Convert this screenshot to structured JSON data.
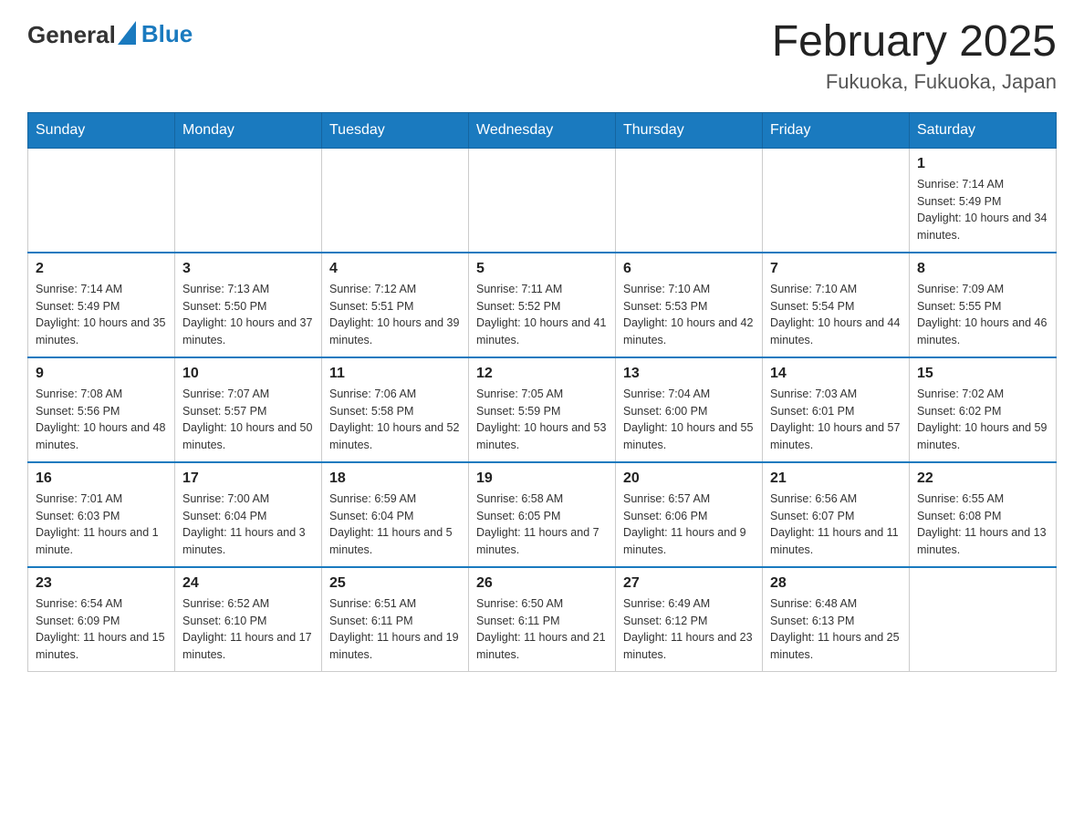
{
  "header": {
    "logo_general": "General",
    "logo_blue": "Blue",
    "title": "February 2025",
    "subtitle": "Fukuoka, Fukuoka, Japan"
  },
  "days_of_week": [
    "Sunday",
    "Monday",
    "Tuesday",
    "Wednesday",
    "Thursday",
    "Friday",
    "Saturday"
  ],
  "weeks": [
    {
      "days": [
        {
          "number": "",
          "sunrise": "",
          "sunset": "",
          "daylight": ""
        },
        {
          "number": "",
          "sunrise": "",
          "sunset": "",
          "daylight": ""
        },
        {
          "number": "",
          "sunrise": "",
          "sunset": "",
          "daylight": ""
        },
        {
          "number": "",
          "sunrise": "",
          "sunset": "",
          "daylight": ""
        },
        {
          "number": "",
          "sunrise": "",
          "sunset": "",
          "daylight": ""
        },
        {
          "number": "",
          "sunrise": "",
          "sunset": "",
          "daylight": ""
        },
        {
          "number": "1",
          "sunrise": "Sunrise: 7:14 AM",
          "sunset": "Sunset: 5:49 PM",
          "daylight": "Daylight: 10 hours and 34 minutes."
        }
      ]
    },
    {
      "days": [
        {
          "number": "2",
          "sunrise": "Sunrise: 7:14 AM",
          "sunset": "Sunset: 5:49 PM",
          "daylight": "Daylight: 10 hours and 35 minutes."
        },
        {
          "number": "3",
          "sunrise": "Sunrise: 7:13 AM",
          "sunset": "Sunset: 5:50 PM",
          "daylight": "Daylight: 10 hours and 37 minutes."
        },
        {
          "number": "4",
          "sunrise": "Sunrise: 7:12 AM",
          "sunset": "Sunset: 5:51 PM",
          "daylight": "Daylight: 10 hours and 39 minutes."
        },
        {
          "number": "5",
          "sunrise": "Sunrise: 7:11 AM",
          "sunset": "Sunset: 5:52 PM",
          "daylight": "Daylight: 10 hours and 41 minutes."
        },
        {
          "number": "6",
          "sunrise": "Sunrise: 7:10 AM",
          "sunset": "Sunset: 5:53 PM",
          "daylight": "Daylight: 10 hours and 42 minutes."
        },
        {
          "number": "7",
          "sunrise": "Sunrise: 7:10 AM",
          "sunset": "Sunset: 5:54 PM",
          "daylight": "Daylight: 10 hours and 44 minutes."
        },
        {
          "number": "8",
          "sunrise": "Sunrise: 7:09 AM",
          "sunset": "Sunset: 5:55 PM",
          "daylight": "Daylight: 10 hours and 46 minutes."
        }
      ]
    },
    {
      "days": [
        {
          "number": "9",
          "sunrise": "Sunrise: 7:08 AM",
          "sunset": "Sunset: 5:56 PM",
          "daylight": "Daylight: 10 hours and 48 minutes."
        },
        {
          "number": "10",
          "sunrise": "Sunrise: 7:07 AM",
          "sunset": "Sunset: 5:57 PM",
          "daylight": "Daylight: 10 hours and 50 minutes."
        },
        {
          "number": "11",
          "sunrise": "Sunrise: 7:06 AM",
          "sunset": "Sunset: 5:58 PM",
          "daylight": "Daylight: 10 hours and 52 minutes."
        },
        {
          "number": "12",
          "sunrise": "Sunrise: 7:05 AM",
          "sunset": "Sunset: 5:59 PM",
          "daylight": "Daylight: 10 hours and 53 minutes."
        },
        {
          "number": "13",
          "sunrise": "Sunrise: 7:04 AM",
          "sunset": "Sunset: 6:00 PM",
          "daylight": "Daylight: 10 hours and 55 minutes."
        },
        {
          "number": "14",
          "sunrise": "Sunrise: 7:03 AM",
          "sunset": "Sunset: 6:01 PM",
          "daylight": "Daylight: 10 hours and 57 minutes."
        },
        {
          "number": "15",
          "sunrise": "Sunrise: 7:02 AM",
          "sunset": "Sunset: 6:02 PM",
          "daylight": "Daylight: 10 hours and 59 minutes."
        }
      ]
    },
    {
      "days": [
        {
          "number": "16",
          "sunrise": "Sunrise: 7:01 AM",
          "sunset": "Sunset: 6:03 PM",
          "daylight": "Daylight: 11 hours and 1 minute."
        },
        {
          "number": "17",
          "sunrise": "Sunrise: 7:00 AM",
          "sunset": "Sunset: 6:04 PM",
          "daylight": "Daylight: 11 hours and 3 minutes."
        },
        {
          "number": "18",
          "sunrise": "Sunrise: 6:59 AM",
          "sunset": "Sunset: 6:04 PM",
          "daylight": "Daylight: 11 hours and 5 minutes."
        },
        {
          "number": "19",
          "sunrise": "Sunrise: 6:58 AM",
          "sunset": "Sunset: 6:05 PM",
          "daylight": "Daylight: 11 hours and 7 minutes."
        },
        {
          "number": "20",
          "sunrise": "Sunrise: 6:57 AM",
          "sunset": "Sunset: 6:06 PM",
          "daylight": "Daylight: 11 hours and 9 minutes."
        },
        {
          "number": "21",
          "sunrise": "Sunrise: 6:56 AM",
          "sunset": "Sunset: 6:07 PM",
          "daylight": "Daylight: 11 hours and 11 minutes."
        },
        {
          "number": "22",
          "sunrise": "Sunrise: 6:55 AM",
          "sunset": "Sunset: 6:08 PM",
          "daylight": "Daylight: 11 hours and 13 minutes."
        }
      ]
    },
    {
      "days": [
        {
          "number": "23",
          "sunrise": "Sunrise: 6:54 AM",
          "sunset": "Sunset: 6:09 PM",
          "daylight": "Daylight: 11 hours and 15 minutes."
        },
        {
          "number": "24",
          "sunrise": "Sunrise: 6:52 AM",
          "sunset": "Sunset: 6:10 PM",
          "daylight": "Daylight: 11 hours and 17 minutes."
        },
        {
          "number": "25",
          "sunrise": "Sunrise: 6:51 AM",
          "sunset": "Sunset: 6:11 PM",
          "daylight": "Daylight: 11 hours and 19 minutes."
        },
        {
          "number": "26",
          "sunrise": "Sunrise: 6:50 AM",
          "sunset": "Sunset: 6:11 PM",
          "daylight": "Daylight: 11 hours and 21 minutes."
        },
        {
          "number": "27",
          "sunrise": "Sunrise: 6:49 AM",
          "sunset": "Sunset: 6:12 PM",
          "daylight": "Daylight: 11 hours and 23 minutes."
        },
        {
          "number": "28",
          "sunrise": "Sunrise: 6:48 AM",
          "sunset": "Sunset: 6:13 PM",
          "daylight": "Daylight: 11 hours and 25 minutes."
        },
        {
          "number": "",
          "sunrise": "",
          "sunset": "",
          "daylight": ""
        }
      ]
    }
  ]
}
